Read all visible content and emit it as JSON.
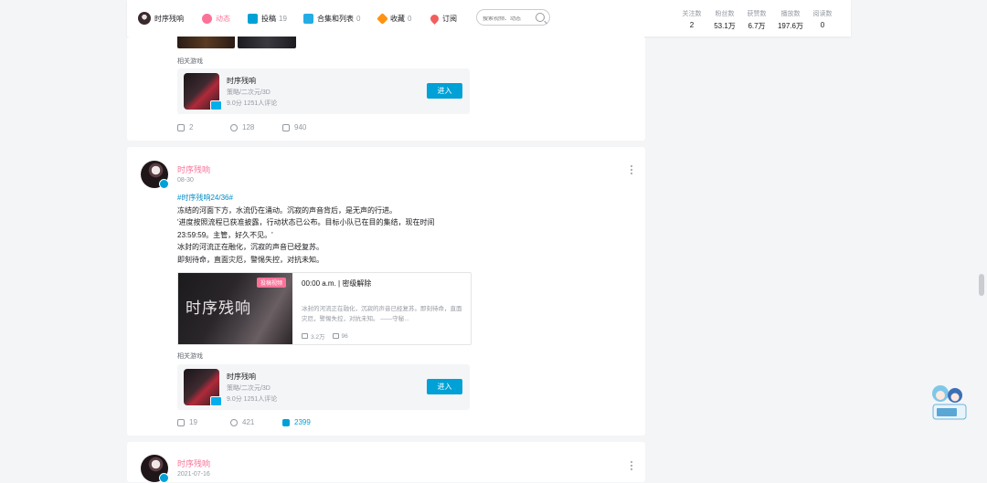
{
  "nav": {
    "username": "时序残响",
    "tabs": [
      {
        "label": "动态",
        "count": ""
      },
      {
        "label": "投稿",
        "count": "19"
      },
      {
        "label": "合集和列表",
        "count": "0"
      },
      {
        "label": "收藏",
        "count": "0"
      },
      {
        "label": "订阅",
        "count": ""
      }
    ],
    "search_placeholder": "搜索视频、动态",
    "stats": [
      {
        "label": "关注数",
        "value": "2"
      },
      {
        "label": "粉丝数",
        "value": "53.1万"
      },
      {
        "label": "获赞数",
        "value": "6.7万"
      },
      {
        "label": "播放数",
        "value": "197.6万"
      },
      {
        "label": "阅读数",
        "value": "0"
      }
    ]
  },
  "related_label": "相关游戏",
  "game": {
    "name": "时序残响",
    "tags": "策略/二次元/3D",
    "score": "9.0分 1251人评论",
    "enter": "进入"
  },
  "posts": [
    {
      "actions": {
        "share": "2",
        "comment": "128",
        "like": "940"
      }
    },
    {
      "user": "时序残响",
      "date": "08-30",
      "tag": "#时序残响24/36#",
      "lines": [
        "冻结的河面下方，水流仍在涌动。沉寂的声音背后，是无声的行进。",
        "'进度按照流程已获准披露，行动状态已公布。目标小队已在目的集结，现在时间",
        "23:59:59。主管，好久不见。'",
        "冰封的河流正在融化，沉寂的声音已经复苏。",
        "即刻待命，直面灾厄，警惕失控，对抗未知。"
      ],
      "video": {
        "badge": "投稿视频",
        "title": "00:00 a.m. | 密级解除",
        "desc": "冰封的河流正在融化，沉寂的声音已经复苏。即刻待命，直面灾厄，警惕失控，对抗未知。 ——守秘...",
        "views": "3.2万",
        "danmaku": "96"
      },
      "actions": {
        "share": "19",
        "comment": "421",
        "like": "2399"
      }
    },
    {
      "user": "时序残响",
      "date": "2021-07-16"
    }
  ],
  "colors": {
    "accent": "#fb7299",
    "primary": "#00a1d6"
  }
}
